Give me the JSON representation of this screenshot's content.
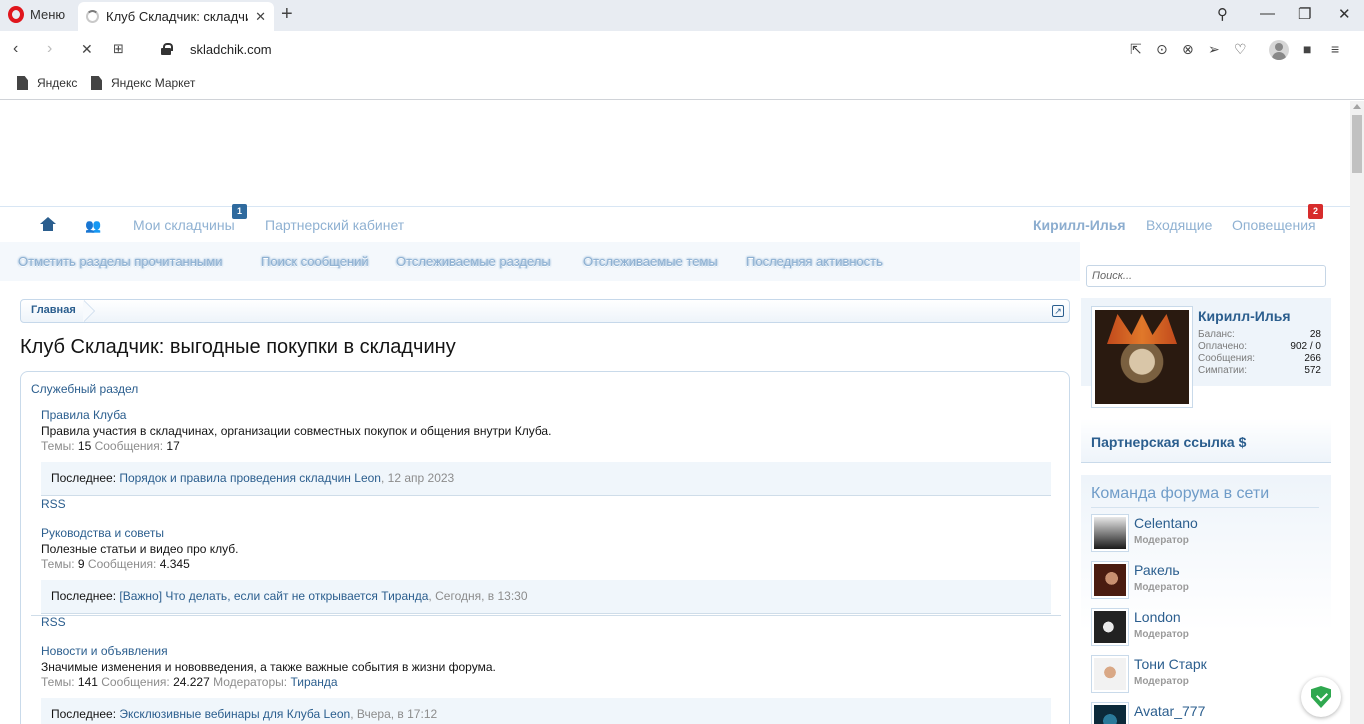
{
  "browser": {
    "menu_label": "Меню",
    "tab_title": "Клуб Складчик: складчина",
    "url": "skladchik.com",
    "bookmarks": [
      "Яндекс",
      "Яндекс Маркет"
    ]
  },
  "navbar": {
    "my_skladchiny": "Мои складчины",
    "my_skladchiny_badge": "1",
    "partner_cabinet": "Партнерский кабинет",
    "username": "Кирилл-Илья",
    "inbox": "Входящие",
    "alerts": "Оповещения",
    "alerts_badge": "2"
  },
  "subnav": {
    "items": [
      "Отметить разделы прочитанными",
      "Поиск сообщений",
      "Отслеживаемые разделы",
      "Отслеживаемые темы",
      "Последняя активность"
    ],
    "search_placeholder": "Поиск..."
  },
  "breadcrumb": {
    "home": "Главная"
  },
  "page_title": "Клуб Складчик: выгодные покупки в складчину",
  "category": {
    "title": "Служебный раздел",
    "labels": {
      "threads": "Темы:",
      "messages": "Сообщения:",
      "moderators": "Модераторы:",
      "last": "Последнее:",
      "rss": "RSS"
    },
    "nodes": [
      {
        "title": "Правила Клуба",
        "description": "Правила участия в складчинах, организации совместных покупок и общения внутри Клуба.",
        "threads": "15",
        "messages": "17",
        "last_title": "Порядок и правила проведения складчин",
        "last_author": "Leon",
        "last_date": "12 апр 2023"
      },
      {
        "title": "Руководства и советы",
        "description": "Полезные статьи и видео про клуб.",
        "threads": "9",
        "messages": "4.345",
        "last_title": "[Важно] Что делать, если сайт не открывается",
        "last_author": "Тиранда",
        "last_date": "Сегодня, в 13:30"
      },
      {
        "title": "Новости и объявления",
        "description": "Значимые изменения и нововведения, а также важные события в жизни форума.",
        "threads": "141",
        "messages": "24.227",
        "moderator": "Тиранда",
        "last_title": "Эксклюзивные вебинары для Клуба",
        "last_author": "Leon",
        "last_date": "Вчера, в 17:12"
      }
    ]
  },
  "sidebar": {
    "username": "Кирилл-Илья",
    "stats": [
      {
        "k": "Баланс:",
        "v": "28"
      },
      {
        "k": "Оплачено:",
        "v": "902 / 0"
      },
      {
        "k": "Сообщения:",
        "v": "266"
      },
      {
        "k": "Симпатии:",
        "v": "572"
      }
    ],
    "partner_link": "Партнерская ссылка $",
    "team_title": "Команда форума в сети",
    "members": [
      {
        "name": "Celentano",
        "role": "Модератор"
      },
      {
        "name": "Ракель",
        "role": "Модератор"
      },
      {
        "name": "London",
        "role": "Модератор"
      },
      {
        "name": "Тони Старк",
        "role": "Модератор"
      },
      {
        "name": "Avatar_777",
        "role": ""
      }
    ]
  },
  "colors": {
    "link": "#2b5e8e",
    "nav_light": "#8fb1d2",
    "badge_blue": "#2f6a9e",
    "badge_red": "#d72c2c"
  }
}
